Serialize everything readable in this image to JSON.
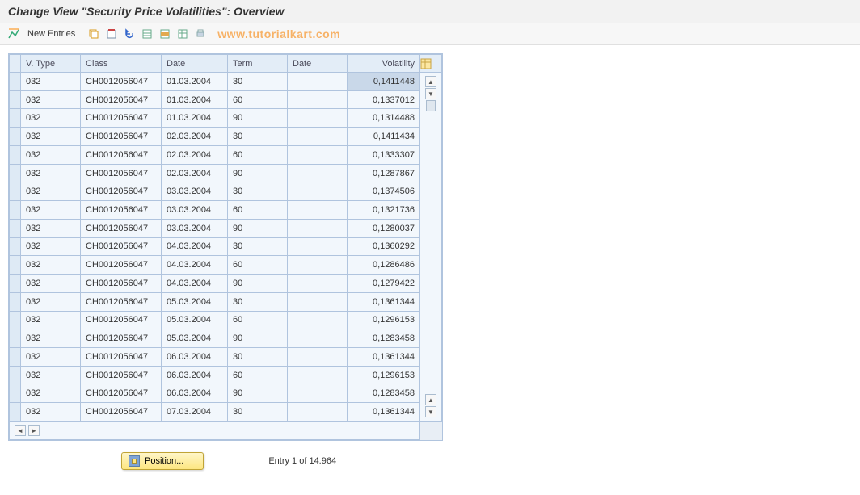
{
  "header": {
    "title": "Change View \"Security Price Volatilities\": Overview"
  },
  "toolbar": {
    "new_entries": "New Entries",
    "watermark": "www.tutorialkart.com"
  },
  "table": {
    "columns": [
      "V. Type",
      "Class",
      "Date",
      "Term",
      "Date",
      "Volatility"
    ],
    "rows": [
      {
        "vtype": "032",
        "class": "CH0012056047",
        "date1": "01.03.2004",
        "term": "30",
        "date2": "",
        "vol": "0,1411448",
        "hl": true
      },
      {
        "vtype": "032",
        "class": "CH0012056047",
        "date1": "01.03.2004",
        "term": "60",
        "date2": "",
        "vol": "0,1337012"
      },
      {
        "vtype": "032",
        "class": "CH0012056047",
        "date1": "01.03.2004",
        "term": "90",
        "date2": "",
        "vol": "0,1314488"
      },
      {
        "vtype": "032",
        "class": "CH0012056047",
        "date1": "02.03.2004",
        "term": "30",
        "date2": "",
        "vol": "0,1411434"
      },
      {
        "vtype": "032",
        "class": "CH0012056047",
        "date1": "02.03.2004",
        "term": "60",
        "date2": "",
        "vol": "0,1333307"
      },
      {
        "vtype": "032",
        "class": "CH0012056047",
        "date1": "02.03.2004",
        "term": "90",
        "date2": "",
        "vol": "0,1287867"
      },
      {
        "vtype": "032",
        "class": "CH0012056047",
        "date1": "03.03.2004",
        "term": "30",
        "date2": "",
        "vol": "0,1374506"
      },
      {
        "vtype": "032",
        "class": "CH0012056047",
        "date1": "03.03.2004",
        "term": "60",
        "date2": "",
        "vol": "0,1321736"
      },
      {
        "vtype": "032",
        "class": "CH0012056047",
        "date1": "03.03.2004",
        "term": "90",
        "date2": "",
        "vol": "0,1280037"
      },
      {
        "vtype": "032",
        "class": "CH0012056047",
        "date1": "04.03.2004",
        "term": "30",
        "date2": "",
        "vol": "0,1360292"
      },
      {
        "vtype": "032",
        "class": "CH0012056047",
        "date1": "04.03.2004",
        "term": "60",
        "date2": "",
        "vol": "0,1286486"
      },
      {
        "vtype": "032",
        "class": "CH0012056047",
        "date1": "04.03.2004",
        "term": "90",
        "date2": "",
        "vol": "0,1279422"
      },
      {
        "vtype": "032",
        "class": "CH0012056047",
        "date1": "05.03.2004",
        "term": "30",
        "date2": "",
        "vol": "0,1361344"
      },
      {
        "vtype": "032",
        "class": "CH0012056047",
        "date1": "05.03.2004",
        "term": "60",
        "date2": "",
        "vol": "0,1296153"
      },
      {
        "vtype": "032",
        "class": "CH0012056047",
        "date1": "05.03.2004",
        "term": "90",
        "date2": "",
        "vol": "0,1283458"
      },
      {
        "vtype": "032",
        "class": "CH0012056047",
        "date1": "06.03.2004",
        "term": "30",
        "date2": "",
        "vol": "0,1361344"
      },
      {
        "vtype": "032",
        "class": "CH0012056047",
        "date1": "06.03.2004",
        "term": "60",
        "date2": "",
        "vol": "0,1296153"
      },
      {
        "vtype": "032",
        "class": "CH0012056047",
        "date1": "06.03.2004",
        "term": "90",
        "date2": "",
        "vol": "0,1283458"
      },
      {
        "vtype": "032",
        "class": "CH0012056047",
        "date1": "07.03.2004",
        "term": "30",
        "date2": "",
        "vol": "0,1361344"
      }
    ]
  },
  "footer": {
    "position_label": "Position...",
    "entry_info": "Entry 1 of 14.964"
  }
}
